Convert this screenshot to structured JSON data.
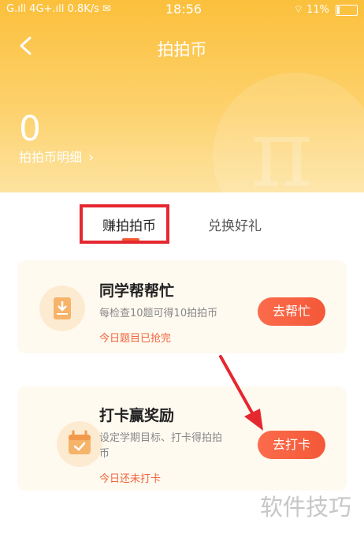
{
  "status_bar": {
    "network": "G.ıll 4G+.ıll",
    "speed": "0.8K/s",
    "wechat_icon": "wechat-icon",
    "time": "18:56",
    "battery": "11%"
  },
  "header": {
    "back_icon": "chevron-left-icon",
    "title": "拍拍币",
    "coin_count": "0",
    "detail_link": "拍拍币明细",
    "detail_chevron": "›"
  },
  "tabs": [
    {
      "label": "赚拍拍币",
      "active": true
    },
    {
      "label": "兑换好礼",
      "active": false
    }
  ],
  "tasks": [
    {
      "title": "同学帮帮忙",
      "desc": "每检查10题可得10拍拍币",
      "status": "今日题目已抢完",
      "button": "去帮忙",
      "icon": "download-document-icon"
    },
    {
      "title": "打卡赢奖励",
      "desc_line1": "设定学期目标、打卡得拍拍",
      "desc_line2": "币",
      "status": "今日还未打卡",
      "button": "去打卡",
      "icon": "calendar-check-icon"
    }
  ],
  "watermark": "软件技巧",
  "colors": {
    "header_yellow": "#fbc03c",
    "accent_orange": "#f35838",
    "highlight_red": "#e52830"
  }
}
